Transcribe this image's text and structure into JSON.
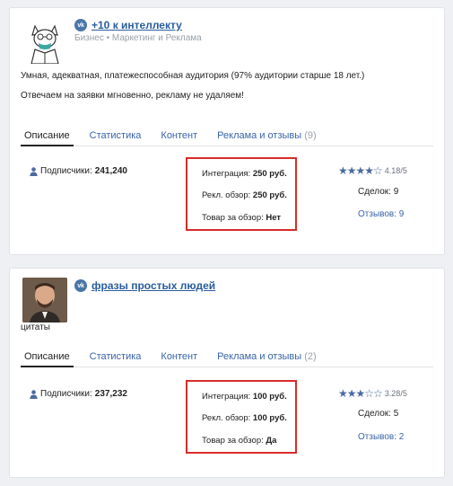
{
  "channels": [
    {
      "vk_badge": "vk",
      "title": "+10 к интеллекту",
      "category": "Бизнес • Маркетинг и Реклама",
      "description": [
        "Умная, адекватная, платежеспособная аудитория (97% аудитории старше 18 лет.)",
        "Отвечаем на заявки мгновенно, рекламу не удаляем!"
      ],
      "tabs": [
        {
          "label": "Описание",
          "count": ""
        },
        {
          "label": "Статистика",
          "count": ""
        },
        {
          "label": "Контент",
          "count": ""
        },
        {
          "label": "Реклама и отзывы",
          "count": "(9)"
        }
      ],
      "subscribers_label": "Подписчики:",
      "subscribers": "241,240",
      "prices": [
        {
          "label": "Интеграция:",
          "value": "250 руб."
        },
        {
          "label": "Рекл. обзор:",
          "value": "250 руб."
        },
        {
          "label": "Товар за обзор:",
          "value": "Нет"
        }
      ],
      "stars": "★★★★☆",
      "rating": "4.18/5",
      "deals": "Сделок: 9",
      "reviews": "Отзывов: 9"
    },
    {
      "vk_badge": "vk",
      "title": "фразы простых людей",
      "category": "",
      "description": [
        "цитаты"
      ],
      "tabs": [
        {
          "label": "Описание",
          "count": ""
        },
        {
          "label": "Статистика",
          "count": ""
        },
        {
          "label": "Контент",
          "count": ""
        },
        {
          "label": "Реклама и отзывы",
          "count": "(2)"
        }
      ],
      "subscribers_label": "Подписчики:",
      "subscribers": "237,232",
      "prices": [
        {
          "label": "Интеграция:",
          "value": "100 руб."
        },
        {
          "label": "Рекл. обзор:",
          "value": "100 руб."
        },
        {
          "label": "Товар за обзор:",
          "value": "Да"
        }
      ],
      "stars": "★★★☆☆",
      "rating": "3.28/5",
      "deals": "Сделок: 5",
      "reviews": "Отзывов: 2"
    }
  ],
  "colors": {
    "highlight_border": "#d92b2b",
    "link": "#3a64a8",
    "vk_badge": "#4a76a8"
  },
  "icons": {
    "avatar_1": "cat-in-suit-avatar",
    "avatar_2": "man-portrait-avatar",
    "subscribers": "person-icon"
  }
}
